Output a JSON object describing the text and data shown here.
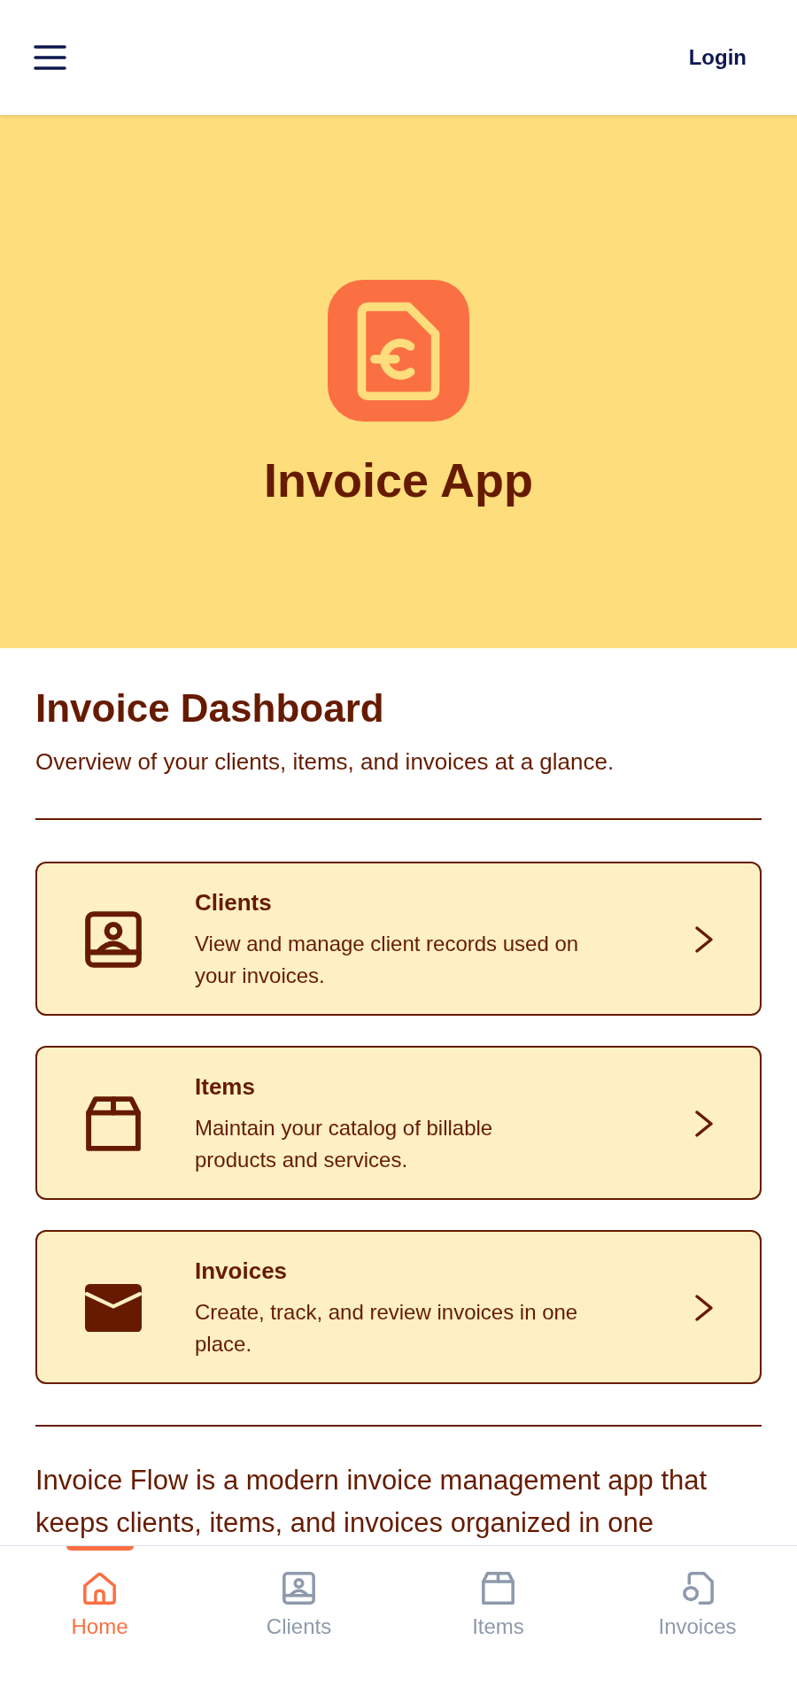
{
  "header": {
    "login": "Login"
  },
  "hero": {
    "title": "Invoice App"
  },
  "dashboard": {
    "title": "Invoice Dashboard",
    "subtitle": "Overview of your clients, items, and invoices at a glance."
  },
  "cards": [
    {
      "title": "Clients",
      "description": "View and manage client records used on your invoices."
    },
    {
      "title": "Items",
      "description": "Maintain your catalog of billable products and services."
    },
    {
      "title": "Invoices",
      "description": "Create, track, and review invoices in one place."
    }
  ],
  "about": {
    "text": "Invoice Flow is a modern invoice management app that keeps clients, items, and invoices organized in one"
  },
  "nav": [
    {
      "label": "Home",
      "selected": true
    },
    {
      "label": "Clients",
      "selected": false
    },
    {
      "label": "Items",
      "selected": false
    },
    {
      "label": "Invoices",
      "selected": false
    }
  ]
}
